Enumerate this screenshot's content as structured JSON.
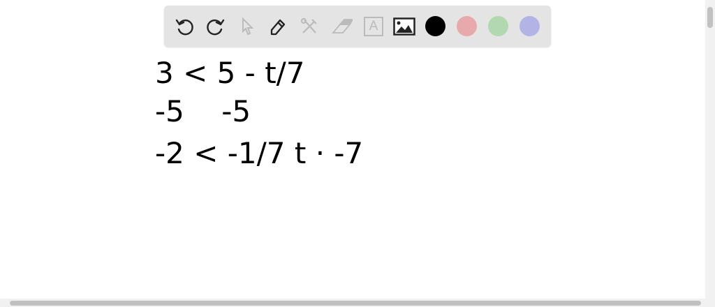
{
  "toolbar": {
    "tools": [
      {
        "name": "undo",
        "icon": "undo-icon",
        "enabled": true
      },
      {
        "name": "redo",
        "icon": "redo-icon",
        "enabled": true
      },
      {
        "name": "select",
        "icon": "pointer-icon",
        "enabled": false
      },
      {
        "name": "pen",
        "icon": "pencil-icon",
        "enabled": true
      },
      {
        "name": "tools",
        "icon": "tools-icon",
        "enabled": false
      },
      {
        "name": "eraser",
        "icon": "eraser-icon",
        "enabled": false
      },
      {
        "name": "text",
        "icon": "text-box-icon",
        "label": "A",
        "enabled": false
      },
      {
        "name": "image",
        "icon": "image-icon",
        "enabled": true
      }
    ],
    "colors": [
      "#000000",
      "#e8a9ad",
      "#b1d8b0",
      "#b3b3e6"
    ],
    "selected_color": "#000000"
  },
  "canvas": {
    "handwriting": "3 < 5 - t/7 ; -5 -5 ; -2 < -1/7 t · -7"
  }
}
